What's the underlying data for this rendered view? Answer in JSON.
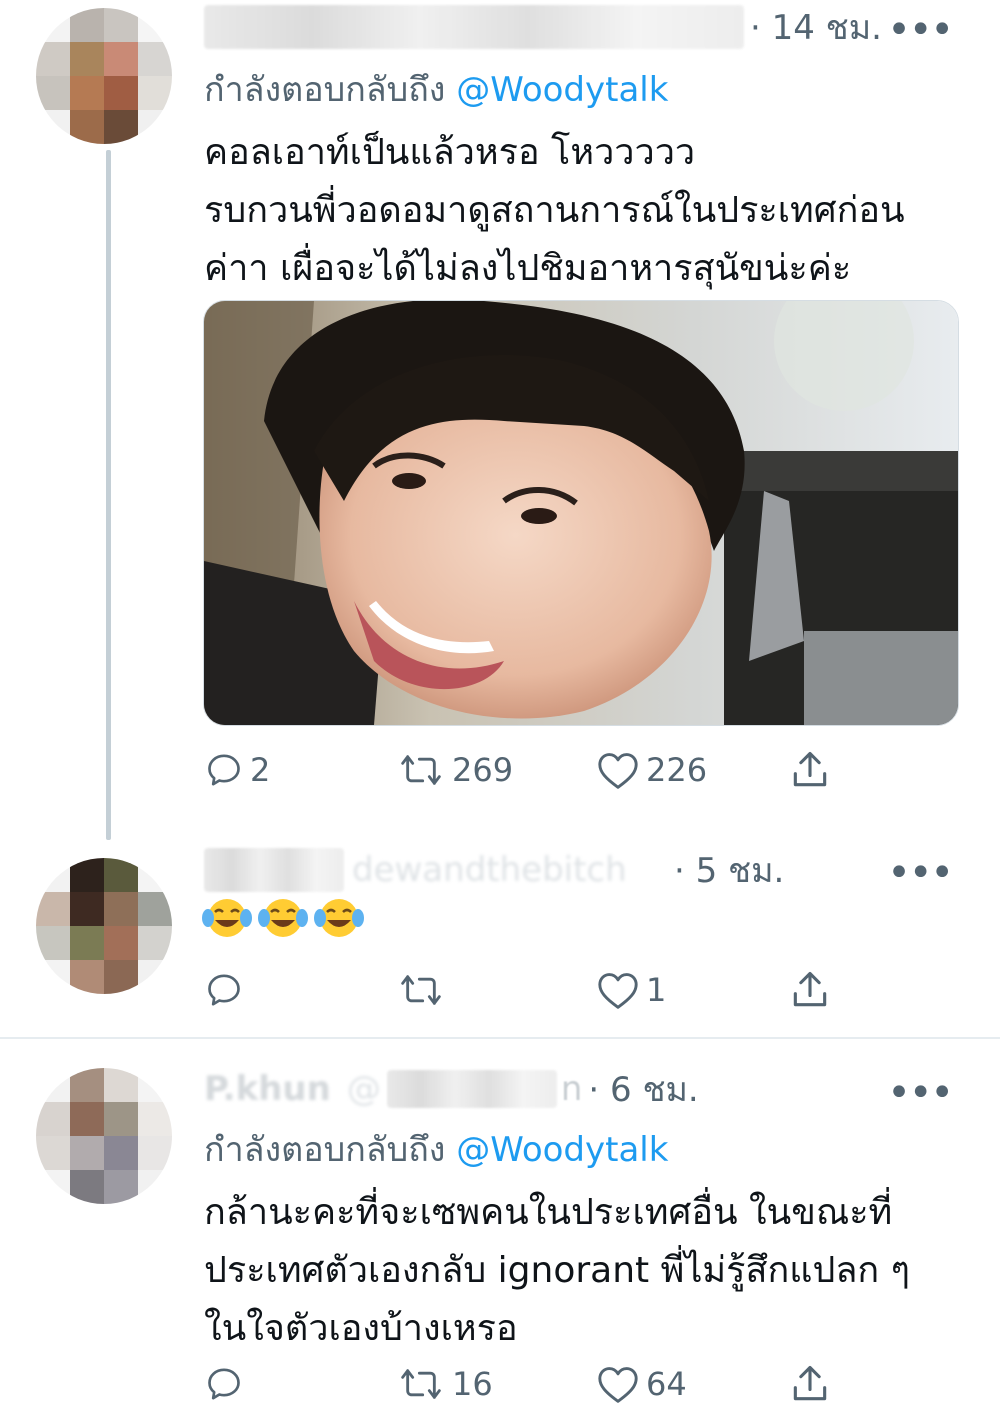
{
  "tweets": [
    {
      "time": "· 14 ชม.",
      "reply_label": "กำลังตอบกลับถึง",
      "reply_mention": "@Woodytalk",
      "text": "คอลเอาท์เป็นแล้วหรอ โหววววว\nรบกวนพี่วอดอมาดูสถานการณ์ในประเทศก่อน\nค่าา เผื่อจะได้ไม่ลงไปชิมอาหารสุนัขน่ะค่ะ",
      "stats": {
        "replies": "2",
        "retweets": "269",
        "likes": "226"
      }
    },
    {
      "blurred_handle": "dewandthebitch",
      "time": "· 5 ชม.",
      "emoji": "😂😂😂",
      "stats": {
        "replies": "",
        "retweets": "",
        "likes": "1"
      }
    },
    {
      "blurred_name": "P.khun",
      "blurred_handle": "@",
      "blurred_tail": "n",
      "time": "· 6 ชม.",
      "reply_label": "กำลังตอบกลับถึง",
      "reply_mention": "@Woodytalk",
      "text": "กล้านะคะที่จะเซพคนในประเทศอื่น ในขณะที่\nประเทศตัวเองกลับ ignorant พี่ไม่รู้สึกแปลก ๆ\nในใจตัวเองบ้างเหรอ",
      "stats": {
        "replies": "",
        "retweets": "16",
        "likes": "64"
      }
    }
  ],
  "icons": {
    "reply": "reply-icon",
    "retweet": "retweet-icon",
    "like": "heart-icon",
    "share": "share-icon",
    "more": "more-icon"
  },
  "colors": {
    "mention": "#1d9bf0",
    "secondary_text": "#536471",
    "thread_line": "#c4cfd6"
  }
}
